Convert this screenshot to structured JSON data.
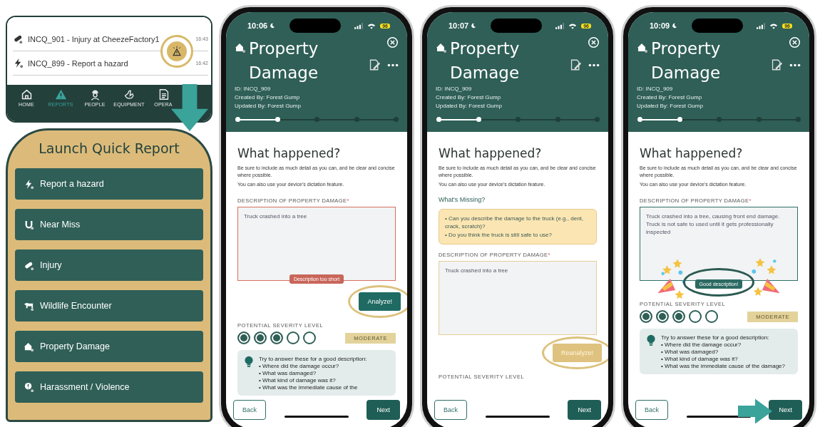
{
  "incident_list": {
    "rows": [
      {
        "kind": "injury",
        "title": "INCQ_901 - Injury at CheezeFactory1",
        "time": "16:43"
      },
      {
        "kind": "hazard",
        "title": "INCQ_899 - Report a hazard",
        "time": "16:42"
      }
    ],
    "quick_report_button": {
      "highlighted": true
    },
    "nav": [
      {
        "kind": "home",
        "label": "HOME",
        "selected": false
      },
      {
        "kind": "reports",
        "label": "REPORTS",
        "selected": true
      },
      {
        "kind": "people",
        "label": "PEOPLE",
        "selected": false
      },
      {
        "kind": "equipment",
        "label": "EQUIPMENT",
        "selected": false
      },
      {
        "kind": "document",
        "label": "OPERA",
        "selected": false
      }
    ]
  },
  "quick_report": {
    "title": "Launch Quick Report",
    "options": [
      {
        "kind": "hazard",
        "label": "Report a hazard"
      },
      {
        "kind": "near_miss",
        "label": "Near Miss"
      },
      {
        "kind": "injury",
        "label": "Injury"
      },
      {
        "kind": "wildlife",
        "label": "Wildlife Encounter"
      },
      {
        "kind": "property",
        "label": "Property Damage"
      },
      {
        "kind": "harassment",
        "label": "Harassment / Violence"
      }
    ]
  },
  "phones": [
    {
      "time": "10:06",
      "battery": "96",
      "title": "Property Damage",
      "id": "ID: INCQ_909",
      "created_by": "Created By: Forest Gump",
      "updated_by": "Updated By: Forest Gump",
      "progress": {
        "level": 0.25
      },
      "heading": "What happened?",
      "intro": [
        "Be sure to include as much detail as you can, and be clear and concise where possible.",
        "You can also use your device's dictation feature."
      ],
      "field": {
        "label": "DESCRIPTION OF PROPERTY DAMAGE",
        "required_mark": "*",
        "value": "Truck crashed into a tree",
        "color": "#d86f5f"
      },
      "feedback": {
        "kind": "error",
        "text": "Description too short",
        "highlighted": false
      },
      "analyze_button": {
        "label": "Analyze!",
        "disabled": false,
        "highlighted": true
      },
      "severity": {
        "label": "POTENTIAL SEVERITY LEVEL",
        "levels": [
          {
            "filled": true
          },
          {
            "filled": true
          },
          {
            "filled": true
          },
          {
            "filled": false
          },
          {
            "filled": false
          }
        ],
        "rating": "MODERATE"
      },
      "tips": {
        "title": "Try to answer these for a good description:",
        "items": [
          "• Where did the damage occur?",
          "• What was damaged?",
          "• What kind of damage was it?",
          "• What was the immediate cause of the"
        ]
      },
      "back": "Back",
      "next": "Next",
      "next_pointed": false
    },
    {
      "time": "10:07",
      "battery": "96",
      "title": "Property Damage",
      "id": "ID: INCQ_909",
      "created_by": "Created By: Forest Gump",
      "updated_by": "Updated By: Forest Gump",
      "progress": {
        "level": 0.25
      },
      "heading": "What happened?",
      "intro": [
        "Be sure to include as much detail as you can, and be clear and concise where possible.",
        "You can also use your device's dictation feature."
      ],
      "missing": {
        "title": "What's Missing?",
        "items": [
          "• Can you describe the damage to the truck (e.g., dent, crack, scratch)?",
          "• Do you think the truck is still safe to use?"
        ]
      },
      "field": {
        "label": "DESCRIPTION OF PROPERTY DAMAGE",
        "required_mark": "*",
        "value": "Truck crashed into a tree",
        "color": "#e5cf96"
      },
      "analyze_button": {
        "label": "Reanalyze!",
        "disabled": true,
        "highlighted": true
      },
      "severity": {
        "label": "POTENTIAL SEVERITY LEVEL"
      },
      "back": "Back",
      "next": "Next",
      "next_pointed": false
    },
    {
      "time": "10:09",
      "battery": "96",
      "title": "Property Damage",
      "id": "ID: INCQ_909",
      "created_by": "Created By: Forest Gump",
      "updated_by": "Updated By: Forest Gump",
      "progress": {
        "level": 0.25
      },
      "heading": "What happened?",
      "intro": [
        "Be sure to include as much detail as you can, and be clear and concise where possible.",
        "You can also use your device's dictation feature."
      ],
      "field": {
        "label": "DESCRIPTION OF PROPERTY DAMAGE",
        "required_mark": "*",
        "value": "Truck crashed into a tree, causing front end damage. Truck is not safe to used until it gets professionally inspected",
        "color": "#2f6f67"
      },
      "feedback": {
        "kind": "success",
        "text": "Good description!",
        "highlighted": true
      },
      "celebration": true,
      "severity": {
        "label": "POTENTIAL SEVERITY LEVEL",
        "levels": [
          {
            "filled": true
          },
          {
            "filled": true
          },
          {
            "filled": true
          },
          {
            "filled": false
          },
          {
            "filled": false
          }
        ],
        "rating": "MODERATE"
      },
      "tips": {
        "title": "Try to answer these for a good description:",
        "items": [
          "• Where did the damage occur?",
          "• What was damaged?",
          "• What kind of damage was it?",
          "• What was the immediate cause of the damage?"
        ]
      },
      "back": "Back",
      "next": "Next",
      "next_pointed": true
    }
  ]
}
